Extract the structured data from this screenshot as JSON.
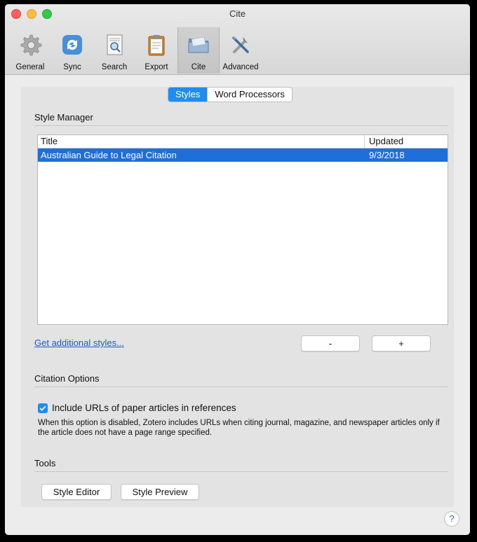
{
  "window": {
    "title": "Cite"
  },
  "toolbar": {
    "items": [
      {
        "label": "General",
        "icon": "gear-icon"
      },
      {
        "label": "Sync",
        "icon": "sync-icon"
      },
      {
        "label": "Search",
        "icon": "search-icon"
      },
      {
        "label": "Export",
        "icon": "clipboard-icon"
      },
      {
        "label": "Cite",
        "icon": "folder-icon",
        "selected": true
      },
      {
        "label": "Advanced",
        "icon": "tools-icon"
      }
    ]
  },
  "tabs": {
    "styles": "Styles",
    "word_processors": "Word Processors",
    "selected": "styles"
  },
  "style_manager": {
    "heading": "Style Manager",
    "columns": {
      "title": "Title",
      "updated": "Updated"
    },
    "rows": [
      {
        "title": "Australian Guide to Legal Citation",
        "updated": "9/3/2018"
      }
    ],
    "get_more_link": "Get additional styles...",
    "remove_label": "-",
    "add_label": "+"
  },
  "citation_options": {
    "heading": "Citation Options",
    "include_urls_label": "Include URLs of paper articles in references",
    "include_urls_checked": true,
    "note": "When this option is disabled, Zotero includes URLs when citing journal, magazine, and newspaper articles only if the article does not have a page range specified."
  },
  "tools": {
    "heading": "Tools",
    "style_editor": "Style Editor",
    "style_preview": "Style Preview"
  },
  "help": {
    "label": "?"
  },
  "colors": {
    "accent": "#1e8cf0",
    "selection": "#1e6fd9",
    "link": "#1a5cc6"
  }
}
